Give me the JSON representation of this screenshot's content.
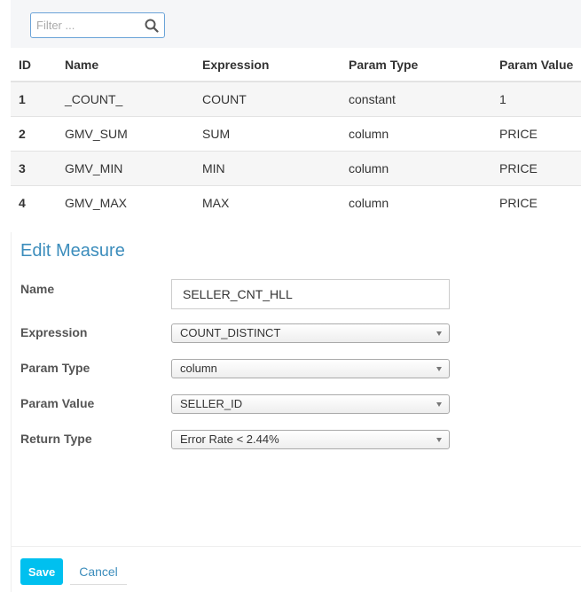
{
  "filter": {
    "placeholder": "Filter ...",
    "value": ""
  },
  "table": {
    "headers": [
      "ID",
      "Name",
      "Expression",
      "Param Type",
      "Param Value"
    ],
    "rows": [
      [
        "1",
        "_COUNT_",
        "COUNT",
        "constant",
        "1"
      ],
      [
        "2",
        "GMV_SUM",
        "SUM",
        "column",
        "PRICE"
      ],
      [
        "3",
        "GMV_MIN",
        "MIN",
        "column",
        "PRICE"
      ],
      [
        "4",
        "GMV_MAX",
        "MAX",
        "column",
        "PRICE"
      ]
    ]
  },
  "edit": {
    "title": "Edit Measure",
    "name_label": "Name",
    "name_value": "SELLER_CNT_HLL",
    "expression_label": "Expression",
    "expression_value": "COUNT_DISTINCT",
    "param_type_label": "Param Type",
    "param_type_value": "column",
    "param_value_label": "Param Value",
    "param_value_value": "SELLER_ID",
    "return_type_label": "Return Type",
    "return_type_value": "Error Rate < 2.44%"
  },
  "actions": {
    "save": "Save",
    "cancel": "Cancel"
  },
  "colors": {
    "accent": "#3c8dbc",
    "save_button": "#00c0ef"
  },
  "icons": {
    "filter": "search-icon",
    "select": "chevron-down-icon"
  }
}
